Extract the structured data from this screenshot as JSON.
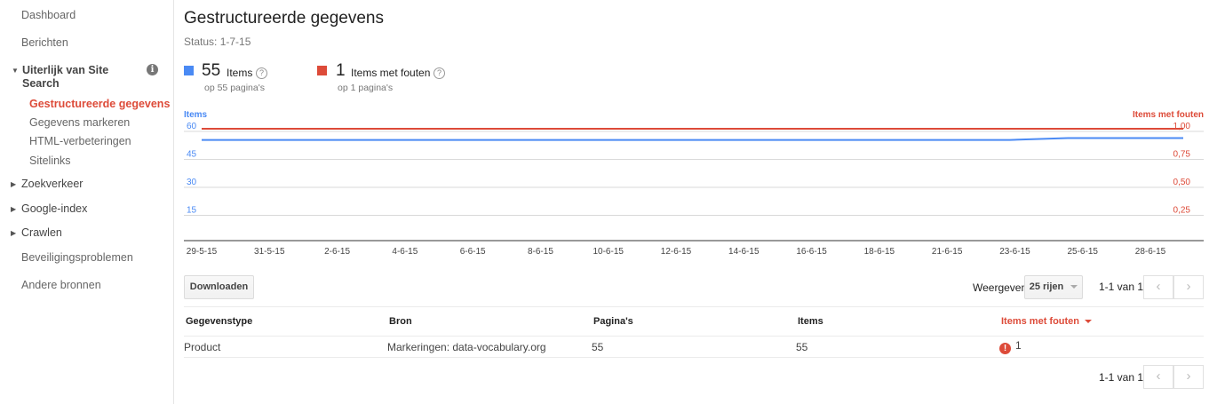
{
  "sidebar": {
    "items": [
      {
        "label": "Dashboard"
      },
      {
        "label": "Berichten"
      }
    ],
    "section": {
      "label": "Uiterlijk van Site Search",
      "subitems": [
        {
          "label": "Gestructureerde gegevens"
        },
        {
          "label": "Gegevens markeren"
        },
        {
          "label": "HTML-verbeteringen"
        },
        {
          "label": "Sitelinks"
        }
      ]
    },
    "collapsed": [
      {
        "label": "Zoekverkeer"
      },
      {
        "label": "Google-index"
      },
      {
        "label": "Crawlen"
      }
    ],
    "bottom": [
      {
        "label": "Beveiligingsproblemen"
      },
      {
        "label": "Andere bronnen"
      }
    ]
  },
  "header": {
    "title": "Gestructureerde gegevens",
    "status": "Status: 1-7-15"
  },
  "legend": {
    "items": {
      "count": "55",
      "label": "Items",
      "sub": "op 55 pagina's",
      "color": "#4a8af4"
    },
    "errors": {
      "count": "1",
      "label": "Items met fouten",
      "sub": "op 1 pagina's",
      "color": "#dd4b39"
    },
    "help": "?"
  },
  "chart_data": {
    "type": "line",
    "y_left_label": "Items",
    "y_right_label": "Items met fouten",
    "y_left_ticks": [
      "60",
      "45",
      "30",
      "15"
    ],
    "y_right_ticks": [
      "1,00",
      "0,75",
      "0,50",
      "0,25"
    ],
    "y_left_range": [
      0,
      60
    ],
    "y_right_range": [
      0,
      1
    ],
    "x_ticks": [
      "29-5-15",
      "31-5-15",
      "2-6-15",
      "4-6-15",
      "6-6-15",
      "8-6-15",
      "10-6-15",
      "12-6-15",
      "14-6-15",
      "16-6-15",
      "18-6-15",
      "21-6-15",
      "23-6-15",
      "25-6-15",
      "28-6-15"
    ],
    "series": [
      {
        "name": "Items",
        "axis": "left",
        "color": "#4a8af4",
        "x": [
          "28-5-15",
          "25-6-15",
          "27-6-15",
          "1-7-15"
        ],
        "values": [
          54,
          54,
          55,
          55
        ]
      },
      {
        "name": "Items met fouten",
        "axis": "right",
        "color": "#dd4b39",
        "x": [
          "28-5-15",
          "1-7-15"
        ],
        "values": [
          1,
          1
        ]
      }
    ]
  },
  "toolbar": {
    "download": "Downloaden",
    "show_label": "Weergeven",
    "rows": "25 rijen",
    "range": "1-1 van 1",
    "prev": "‹",
    "next": "›"
  },
  "table": {
    "headers": [
      "Gegevenstype",
      "Bron",
      "Pagina's",
      "Items",
      "Items met fouten"
    ],
    "rows": [
      {
        "type": "Product",
        "source": "Markeringen: data-vocabulary.org",
        "pages": "55",
        "items": "55",
        "errors": "1"
      }
    ],
    "error_icon": "!"
  }
}
